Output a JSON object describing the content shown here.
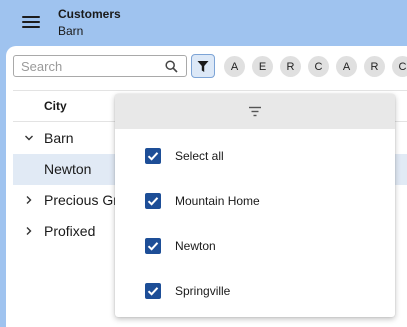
{
  "app": {
    "title": "Customers",
    "subtitle": "Barn"
  },
  "toolbar": {
    "search_placeholder": "Search",
    "chips": [
      "A",
      "E",
      "R",
      "C",
      "A",
      "R",
      "C"
    ]
  },
  "list": {
    "column_header": "City",
    "rows": [
      {
        "label": "Barn",
        "expanded": true,
        "selected": false
      },
      {
        "label": "Newton",
        "expanded": null,
        "selected": true
      },
      {
        "label": "Precious Gr",
        "expanded": false,
        "selected": false
      },
      {
        "label": "Profixed",
        "expanded": false,
        "selected": false
      }
    ]
  },
  "filter_popup": {
    "options": [
      {
        "label": "Select all",
        "checked": true
      },
      {
        "label": "Mountain Home",
        "checked": true
      },
      {
        "label": "Newton",
        "checked": true
      },
      {
        "label": "Springville",
        "checked": true
      }
    ]
  },
  "colors": {
    "appbar": "#9fc3ef",
    "accent": "#1d4e97",
    "selected_row": "#e1eaf5"
  }
}
